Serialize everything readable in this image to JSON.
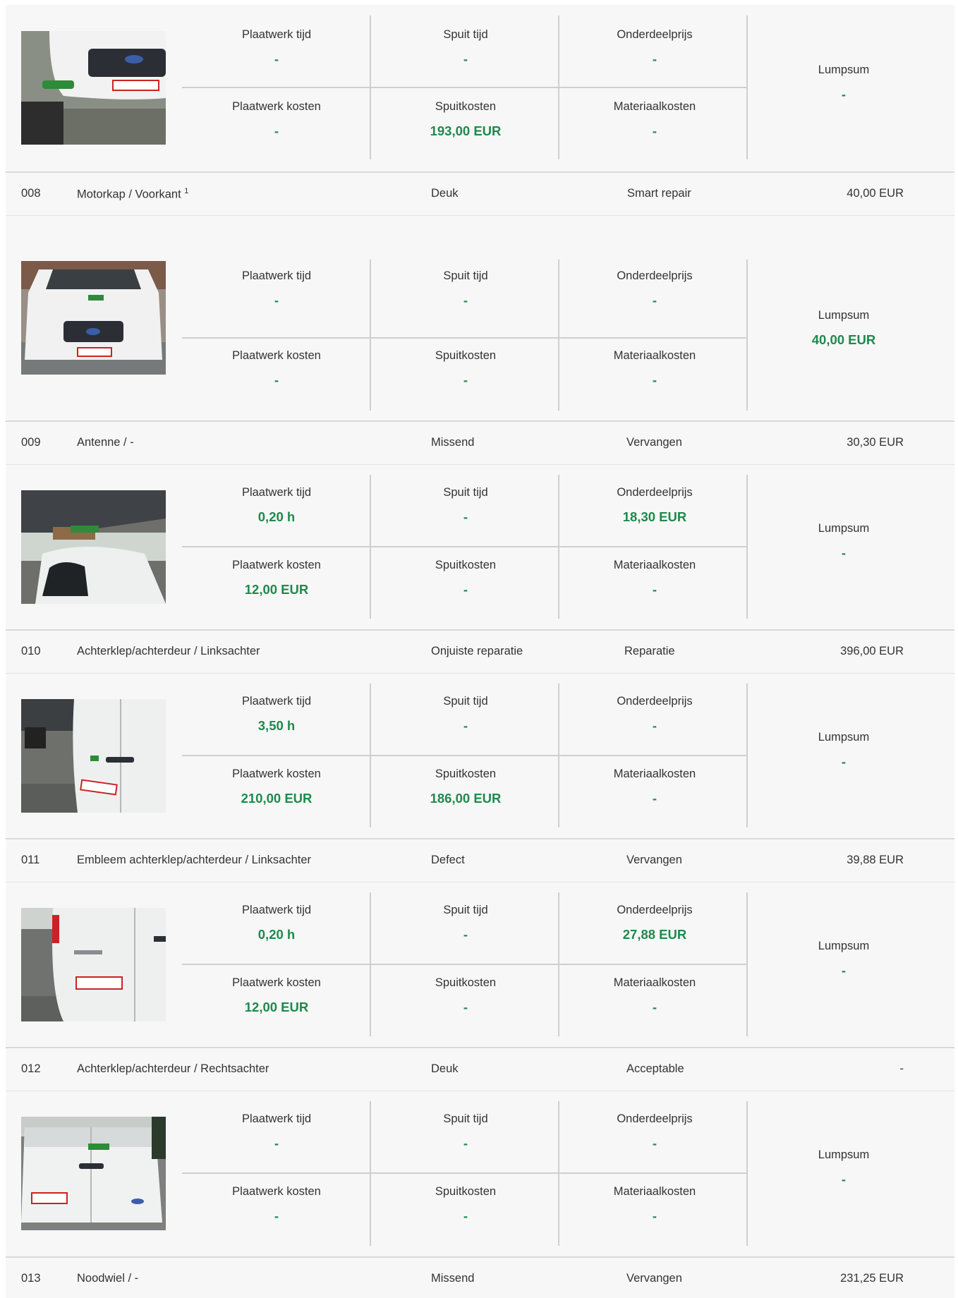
{
  "labels": {
    "plaatwerk_tijd": "Plaatwerk tijd",
    "spuit_tijd": "Spuit tijd",
    "onderdeelprijs": "Onderdeelprijs",
    "plaatwerk_kosten": "Plaatwerk kosten",
    "spuitkosten": "Spuitkosten",
    "materiaalkosten": "Materiaalkosten",
    "lumpsum": "Lumpsum"
  },
  "colors": {
    "value_green": "#1e8a4c",
    "background": "#f7f7f7",
    "divider": "#d9d9d9"
  },
  "details": [
    {
      "photo": "photo-front-key",
      "plaatwerk_tijd": "-",
      "spuit_tijd": "-",
      "onderdeelprijs": "-",
      "plaatwerk_kosten": "-",
      "spuitkosten": "193,00 EUR",
      "materiaalkosten": "-",
      "lumpsum": "-"
    },
    {
      "photo": "photo-front-hood",
      "plaatwerk_tijd": "-",
      "spuit_tijd": "-",
      "onderdeelprijs": "-",
      "plaatwerk_kosten": "-",
      "spuitkosten": "-",
      "materiaalkosten": "-",
      "lumpsum": "40,00 EUR"
    },
    {
      "photo": "photo-roof",
      "plaatwerk_tijd": "0,20 h",
      "spuit_tijd": "-",
      "onderdeelprijs": "18,30 EUR",
      "plaatwerk_kosten": "12,00 EUR",
      "spuitkosten": "-",
      "materiaalkosten": "-",
      "lumpsum": "-"
    },
    {
      "photo": "photo-rear-left-door",
      "plaatwerk_tijd": "3,50 h",
      "spuit_tijd": "-",
      "onderdeelprijs": "-",
      "plaatwerk_kosten": "210,00 EUR",
      "spuitkosten": "186,00 EUR",
      "materiaalkosten": "-",
      "lumpsum": "-"
    },
    {
      "photo": "photo-rear-left-emblem",
      "plaatwerk_tijd": "0,20 h",
      "spuit_tijd": "-",
      "onderdeelprijs": "27,88 EUR",
      "plaatwerk_kosten": "12,00 EUR",
      "spuitkosten": "-",
      "materiaalkosten": "-",
      "lumpsum": "-"
    },
    {
      "photo": "photo-rear-right-door",
      "plaatwerk_tijd": "-",
      "spuit_tijd": "-",
      "onderdeelprijs": "-",
      "plaatwerk_kosten": "-",
      "spuitkosten": "-",
      "materiaalkosten": "-",
      "lumpsum": "-"
    }
  ],
  "items": [
    {
      "code": "008",
      "part": "Motorkap / Voorkant",
      "footnote": "1",
      "damage": "Deuk",
      "action": "Smart repair",
      "amount": "40,00 EUR"
    },
    {
      "code": "009",
      "part": "Antenne / -",
      "footnote": "",
      "damage": "Missend",
      "action": "Vervangen",
      "amount": "30,30 EUR"
    },
    {
      "code": "010",
      "part": "Achterklep/achterdeur / Linksachter",
      "footnote": "",
      "damage": "Onjuiste reparatie",
      "action": "Reparatie",
      "amount": "396,00 EUR"
    },
    {
      "code": "011",
      "part": "Embleem achterklep/achterdeur / Linksachter",
      "footnote": "",
      "damage": "Defect",
      "action": "Vervangen",
      "amount": "39,88 EUR"
    },
    {
      "code": "012",
      "part": "Achterklep/achterdeur / Rechtsachter",
      "footnote": "",
      "damage": "Deuk",
      "action": "Acceptable",
      "amount": "-"
    },
    {
      "code": "013",
      "part": "Noodwiel / -",
      "footnote": "",
      "damage": "Missend",
      "action": "Vervangen",
      "amount": "231,25 EUR"
    }
  ]
}
